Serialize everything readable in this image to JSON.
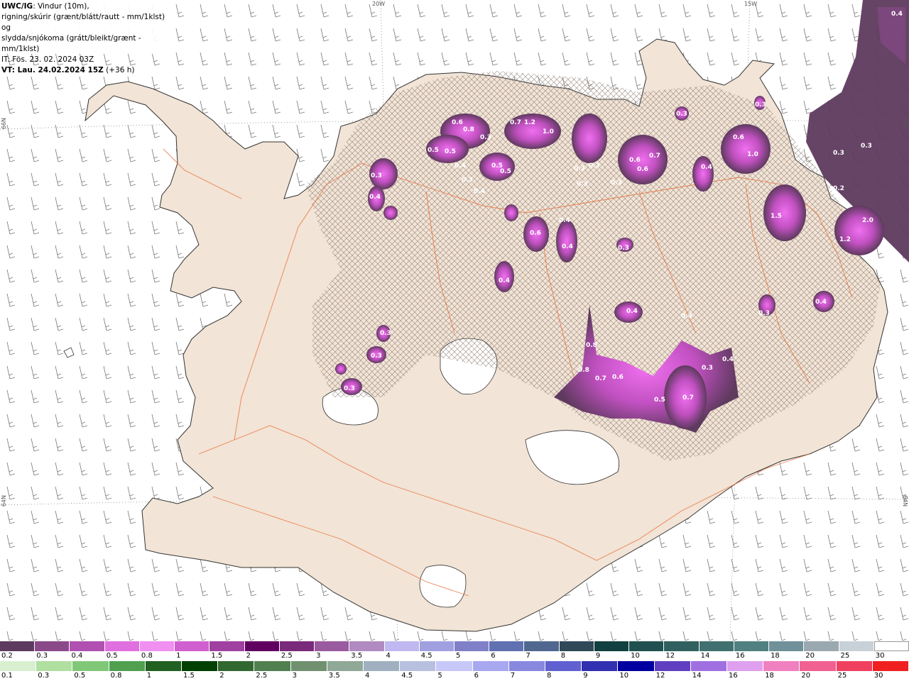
{
  "header": {
    "code": "UWC/IG",
    "line1": ": Vindur (10m),",
    "line2": "rigning/skúrir (grænt/blátt/rautt - mm/1klst) og",
    "line3": "slydda/snjókoma (grátt/bleikt/grænt - mm/1klst)",
    "it": "IT: Fös. 23. 02. 2024 03Z",
    "vt": "VT: Lau. 24.02.2024 15Z",
    "vt_offset": " (+36 h)"
  },
  "grid_labels": {
    "lon_20w": "20W",
    "lon_15w": "15W",
    "lat_66n_left": "66N",
    "lat_66n_right": "66N",
    "lat_64n_left": "64N",
    "lat_64n_right": "64N"
  },
  "map_labels": [
    "0.4",
    "0.3",
    "0.3",
    "0.6",
    "0.8",
    "0.3",
    "0.5",
    "0.5",
    "0.4",
    "0.5",
    "0.5",
    "0.3",
    "0.4",
    "0.7",
    "1.2",
    "1.0",
    "0.3",
    "0.3",
    "0.3",
    "0.6",
    "0.7",
    "0.6",
    "0.3",
    "0.4",
    "0.6",
    "1.0",
    "0.3",
    "0.3",
    "0.2",
    "1.5",
    "2.0",
    "1.2",
    "0.4",
    "0.6",
    "0.4",
    "0.3",
    "0.4",
    "0.4",
    "0.3",
    "0.4",
    "0.3",
    "0.4",
    "0.3",
    "0.3",
    "0.8",
    "0.8",
    "0.7",
    "0.6",
    "0.5",
    "0.7",
    "0.4",
    "0.3",
    "0.4",
    "0.3"
  ],
  "legend_snow": {
    "labels": [
      "0.2",
      "0.3",
      "0.4",
      "0.5",
      "0.8",
      "1",
      "1.5",
      "2",
      "2.5",
      "3",
      "3.5",
      "4",
      "4.5",
      "5",
      "6",
      "7",
      "8",
      "9",
      "10",
      "12",
      "14",
      "16",
      "18",
      "20",
      "25",
      "30"
    ],
    "colors": [
      "#5e3a5e",
      "#8a4a8a",
      "#b050b0",
      "#e070e0",
      "#f090f0",
      "#d060d0",
      "#a040a0",
      "#600060",
      "#7a2a7a",
      "#9a5aa0",
      "#b08ac0",
      "#c0b8f0",
      "#a0a0e0",
      "#8080c8",
      "#6070b0",
      "#506890",
      "#304858",
      "#104040",
      "#205050",
      "#306060",
      "#407070",
      "#508080",
      "#70909a",
      "#9aa8b0",
      "#c8d0d8",
      "#ffffff"
    ]
  },
  "legend_rain": {
    "labels": [
      "0.1",
      "0.3",
      "0.5",
      "0.8",
      "1",
      "1.5",
      "2",
      "2.5",
      "3",
      "3.5",
      "4",
      "4.5",
      "5",
      "6",
      "7",
      "8",
      "9",
      "10",
      "12",
      "14",
      "16",
      "18",
      "20",
      "25",
      "30"
    ],
    "colors": [
      "#d8f0d0",
      "#b0e0a0",
      "#80c878",
      "#50a050",
      "#206020",
      "#004000",
      "#306830",
      "#508050",
      "#709070",
      "#90a898",
      "#a0b0c0",
      "#b8c0e0",
      "#c8c8f8",
      "#a8a8f0",
      "#8888e0",
      "#6060d0",
      "#3030b0",
      "#0000a0",
      "#6040c0",
      "#a070e0",
      "#e0a0f0",
      "#f080c0",
      "#f06090",
      "#f04060",
      "#f02020"
    ]
  }
}
